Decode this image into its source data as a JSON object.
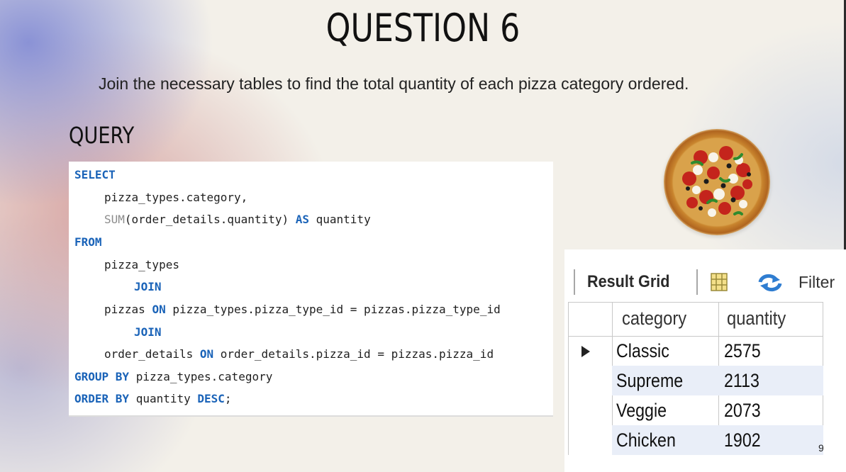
{
  "slide": {
    "title": "QUESTION 6",
    "subtitle": "Join the necessary tables to find the total quantity of each pizza category ordered.",
    "query_heading": "QUERY",
    "page_number": "9"
  },
  "code": {
    "lines": [
      {
        "kw": "SELECT"
      },
      {
        "text": "pizza_types.category,"
      },
      {
        "fn": "SUM",
        "text1": "(order_details.quantity) ",
        "kw": "AS",
        "text2": " quantity"
      },
      {
        "kw": "FROM"
      },
      {
        "text": "pizza_types"
      },
      {
        "kw": "JOIN"
      },
      {
        "text1": "pizzas ",
        "kw": "ON",
        "text2": " pizza_types.pizza_type_id = pizzas.pizza_type_id"
      },
      {
        "kw": "JOIN"
      },
      {
        "text1": "order_details ",
        "kw": "ON",
        "text2": " order_details.pizza_id = pizzas.pizza_id"
      },
      {
        "kw": "GROUP BY",
        "text2": " pizza_types.category"
      },
      {
        "kw": "ORDER BY",
        "text2": " quantity ",
        "kw2": "DESC",
        "text3": ";"
      }
    ]
  },
  "result_grid": {
    "toolbar_label": "Result Grid",
    "filter_label": "Filter",
    "columns": [
      "category",
      "quantity"
    ],
    "rows": [
      {
        "category": "Classic",
        "quantity": "2575"
      },
      {
        "category": "Supreme",
        "quantity": "2113"
      },
      {
        "category": "Veggie",
        "quantity": "2073"
      },
      {
        "category": "Chicken",
        "quantity": "1902"
      }
    ],
    "selected_row_icon": "row-pointer-icon"
  },
  "icons": [
    "grid-icon",
    "refresh-icon",
    "pizza-image"
  ],
  "colors": {
    "keyword": "#1a63b8",
    "function": "#8c8c8c",
    "background": "#f3f0e9"
  }
}
